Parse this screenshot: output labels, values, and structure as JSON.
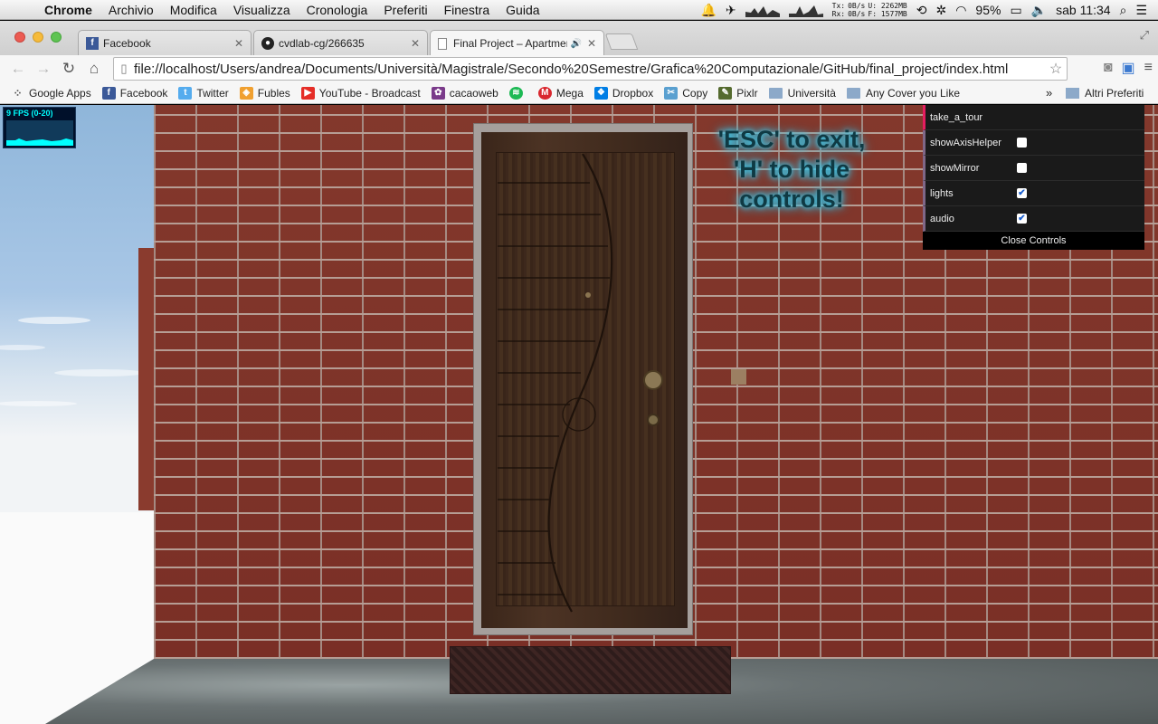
{
  "menubar": {
    "apple_icon": "apple-icon",
    "items": [
      "Chrome",
      "Archivio",
      "Modifica",
      "Visualizza",
      "Cronologia",
      "Preferiti",
      "Finestra",
      "Guida"
    ],
    "net": {
      "tx_label": "Tx:",
      "rx_label": "Rx:",
      "tx_rate": "0B/s",
      "rx_rate": "0B/s",
      "used": "U: 2262MB",
      "free": "F: 1577MB"
    },
    "battery": "95%",
    "clock": "sab 11:34"
  },
  "tabs": [
    {
      "title": "Facebook",
      "favicon": "f",
      "favicon_color": "#3b5998"
    },
    {
      "title": "cvdlab-cg/266635",
      "favicon": "●",
      "favicon_color": "#222"
    },
    {
      "title": "Final Project – Apartment",
      "favicon": "▭",
      "favicon_color": "#888",
      "speaker": "🔊"
    }
  ],
  "url": "file://localhost/Users/andrea/Documents/Università/Magistrale/Secondo%20Semestre/Grafica%20Computazionale/GitHub/final_project/index.html",
  "bookmarks": [
    {
      "label": "Google Apps",
      "icon": "⁘",
      "color": "#555"
    },
    {
      "label": "Facebook",
      "icon": "f",
      "color": "#3b5998"
    },
    {
      "label": "Twitter",
      "icon": "t",
      "color": "#55acee"
    },
    {
      "label": "Fubles",
      "icon": "◈",
      "color": "#f0a030"
    },
    {
      "label": "YouTube - Broadcast Yourself",
      "icon": "▶",
      "color": "#e52d27"
    },
    {
      "label": "cacaoweb",
      "icon": "✿",
      "color": "#7a3a8a"
    },
    {
      "label": "",
      "icon": "≋",
      "color": "#1db954"
    },
    {
      "label": "Mega",
      "icon": "M",
      "color": "#d9272e"
    },
    {
      "label": "Dropbox",
      "icon": "❖",
      "color": "#007ee5"
    },
    {
      "label": "Copy",
      "icon": "✂",
      "color": "#5aa0d0"
    },
    {
      "label": "Pixlr",
      "icon": "✎",
      "color": "#556b2f"
    },
    {
      "label": "Università",
      "icon": "folder",
      "color": "#8ca9c9"
    },
    {
      "label": "Any Cover you Like",
      "icon": "folder",
      "color": "#8ca9c9"
    }
  ],
  "bookmarks_overflow": "»",
  "other_bookmarks": "Altri Preferiti",
  "stats": {
    "label": "9 FPS (0-20)"
  },
  "hint": {
    "line1": "'ESC' to exit,",
    "line2": "'H' to hide",
    "line3": "controls!"
  },
  "gui": {
    "rows": [
      {
        "name": "take_a_tour",
        "type": "function"
      },
      {
        "name": "showAxisHelper",
        "type": "boolean",
        "checked": false
      },
      {
        "name": "showMirror",
        "type": "boolean",
        "checked": false
      },
      {
        "name": "lights",
        "type": "boolean",
        "checked": true
      },
      {
        "name": "audio",
        "type": "boolean",
        "checked": true
      }
    ],
    "close_label": "Close Controls"
  }
}
